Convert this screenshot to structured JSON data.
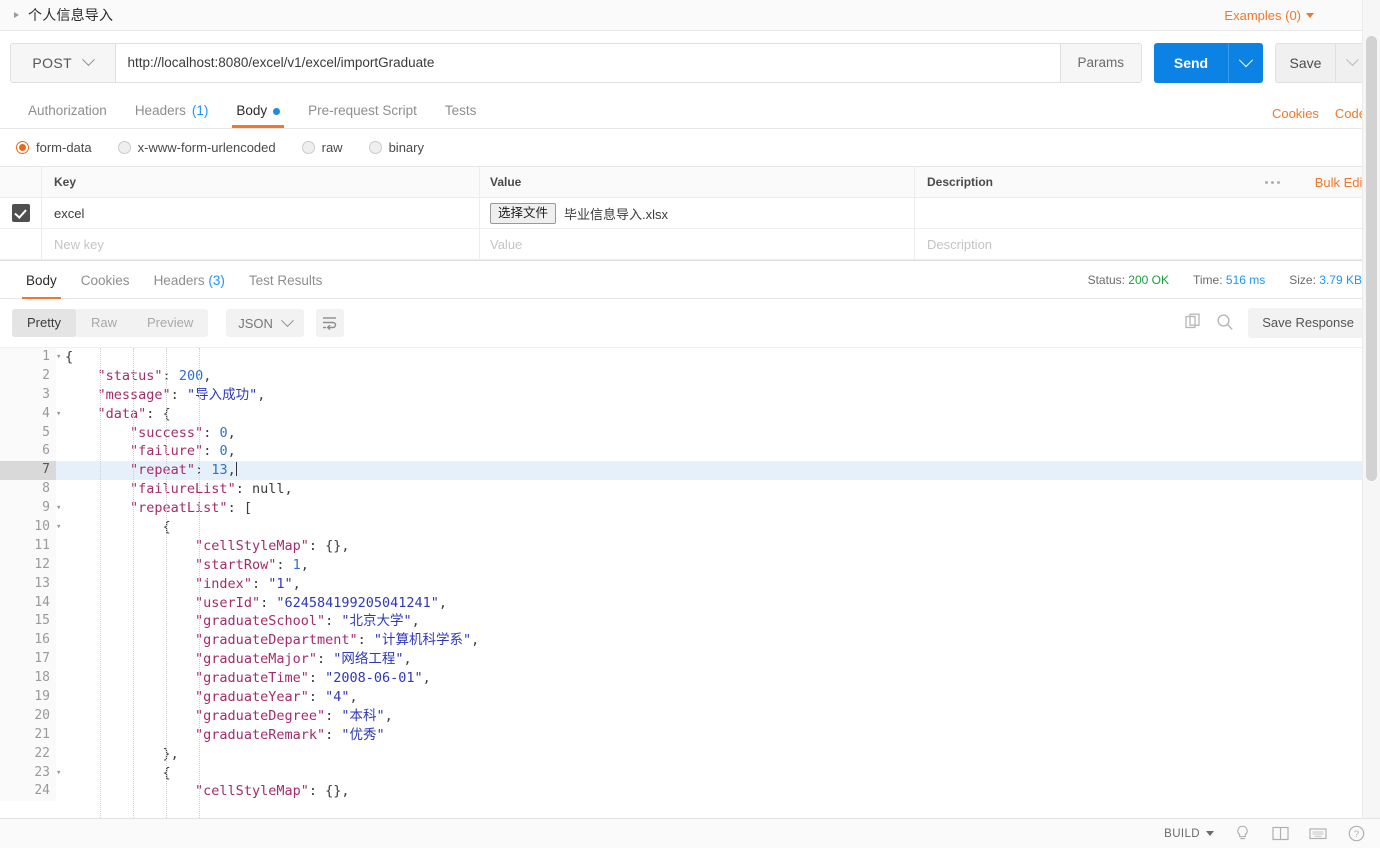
{
  "request": {
    "name": "个人信息导入",
    "examples_label": "Examples (0)",
    "method": "POST",
    "url": "http://localhost:8080/excel/v1/excel/importGraduate",
    "params_label": "Params",
    "send_label": "Send",
    "save_label": "Save",
    "tabs": [
      {
        "label": "Authorization",
        "active": false,
        "badge": ""
      },
      {
        "label": "Headers",
        "active": false,
        "badge": "(1)"
      },
      {
        "label": "Body",
        "active": true,
        "badge": ""
      },
      {
        "label": "Pre-request Script",
        "active": false,
        "badge": ""
      },
      {
        "label": "Tests",
        "active": false,
        "badge": ""
      }
    ],
    "links": {
      "cookies": "Cookies",
      "code": "Code"
    }
  },
  "body": {
    "types": [
      {
        "label": "form-data",
        "selected": true
      },
      {
        "label": "x-www-form-urlencoded",
        "selected": false
      },
      {
        "label": "raw",
        "selected": false
      },
      {
        "label": "binary",
        "selected": false
      }
    ],
    "table": {
      "headers": {
        "key": "Key",
        "value": "Value",
        "description": "Description"
      },
      "bulk_edit": "Bulk Edit",
      "rows": [
        {
          "checked": true,
          "key": "excel",
          "file_button": "选择文件",
          "file_name": "毕业信息导入.xlsx",
          "description": ""
        }
      ],
      "new_row": {
        "key_placeholder": "New key",
        "value_placeholder": "Value",
        "description_placeholder": "Description"
      }
    }
  },
  "response": {
    "tabs": [
      {
        "label": "Body",
        "active": true,
        "badge": ""
      },
      {
        "label": "Cookies",
        "active": false,
        "badge": ""
      },
      {
        "label": "Headers",
        "active": false,
        "badge": "(3)"
      },
      {
        "label": "Test Results",
        "active": false,
        "badge": ""
      }
    ],
    "status": {
      "status_label": "Status:",
      "status_value": "200 OK",
      "time_label": "Time:",
      "time_value": "516 ms",
      "size_label": "Size:",
      "size_value": "3.79 KB"
    },
    "view_modes": [
      {
        "label": "Pretty",
        "active": true
      },
      {
        "label": "Raw",
        "active": false
      },
      {
        "label": "Preview",
        "active": false
      }
    ],
    "format": "JSON",
    "save_response": "Save Response",
    "lines": [
      {
        "num": "1",
        "fold": true,
        "indent": 0,
        "tokens": [
          {
            "t": "p",
            "v": "{"
          }
        ]
      },
      {
        "num": "2",
        "fold": false,
        "indent": 1,
        "tokens": [
          {
            "t": "k",
            "v": "\"status\""
          },
          {
            "t": "p",
            "v": ": "
          },
          {
            "t": "n",
            "v": "200"
          },
          {
            "t": "p",
            "v": ","
          }
        ]
      },
      {
        "num": "3",
        "fold": false,
        "indent": 1,
        "tokens": [
          {
            "t": "k",
            "v": "\"message\""
          },
          {
            "t": "p",
            "v": ": "
          },
          {
            "t": "s",
            "v": "\"导入成功\""
          },
          {
            "t": "p",
            "v": ","
          }
        ]
      },
      {
        "num": "4",
        "fold": true,
        "indent": 1,
        "tokens": [
          {
            "t": "k",
            "v": "\"data\""
          },
          {
            "t": "p",
            "v": ": {"
          }
        ]
      },
      {
        "num": "5",
        "fold": false,
        "indent": 2,
        "tokens": [
          {
            "t": "k",
            "v": "\"success\""
          },
          {
            "t": "p",
            "v": ": "
          },
          {
            "t": "n",
            "v": "0"
          },
          {
            "t": "p",
            "v": ","
          }
        ]
      },
      {
        "num": "6",
        "fold": false,
        "indent": 2,
        "tokens": [
          {
            "t": "k",
            "v": "\"failure\""
          },
          {
            "t": "p",
            "v": ": "
          },
          {
            "t": "n",
            "v": "0"
          },
          {
            "t": "p",
            "v": ","
          }
        ]
      },
      {
        "num": "7",
        "fold": false,
        "indent": 2,
        "highlight": true,
        "cursor": true,
        "tokens": [
          {
            "t": "k",
            "v": "\"repeat\""
          },
          {
            "t": "p",
            "v": ": "
          },
          {
            "t": "n",
            "v": "13"
          },
          {
            "t": "p",
            "v": ","
          }
        ]
      },
      {
        "num": "8",
        "fold": false,
        "indent": 2,
        "tokens": [
          {
            "t": "k",
            "v": "\"failureList\""
          },
          {
            "t": "p",
            "v": ": "
          },
          {
            "t": "nul",
            "v": "null"
          },
          {
            "t": "p",
            "v": ","
          }
        ]
      },
      {
        "num": "9",
        "fold": true,
        "indent": 2,
        "tokens": [
          {
            "t": "k",
            "v": "\"repeatList\""
          },
          {
            "t": "p",
            "v": ": ["
          }
        ]
      },
      {
        "num": "10",
        "fold": true,
        "indent": 3,
        "tokens": [
          {
            "t": "p",
            "v": "{"
          }
        ]
      },
      {
        "num": "11",
        "fold": false,
        "indent": 4,
        "tokens": [
          {
            "t": "k",
            "v": "\"cellStyleMap\""
          },
          {
            "t": "p",
            "v": ": {},"
          }
        ]
      },
      {
        "num": "12",
        "fold": false,
        "indent": 4,
        "tokens": [
          {
            "t": "k",
            "v": "\"startRow\""
          },
          {
            "t": "p",
            "v": ": "
          },
          {
            "t": "n",
            "v": "1"
          },
          {
            "t": "p",
            "v": ","
          }
        ]
      },
      {
        "num": "13",
        "fold": false,
        "indent": 4,
        "tokens": [
          {
            "t": "k",
            "v": "\"index\""
          },
          {
            "t": "p",
            "v": ": "
          },
          {
            "t": "s",
            "v": "\"1\""
          },
          {
            "t": "p",
            "v": ","
          }
        ]
      },
      {
        "num": "14",
        "fold": false,
        "indent": 4,
        "tokens": [
          {
            "t": "k",
            "v": "\"userId\""
          },
          {
            "t": "p",
            "v": ": "
          },
          {
            "t": "s",
            "v": "\"624584199205041241\""
          },
          {
            "t": "p",
            "v": ","
          }
        ]
      },
      {
        "num": "15",
        "fold": false,
        "indent": 4,
        "tokens": [
          {
            "t": "k",
            "v": "\"graduateSchool\""
          },
          {
            "t": "p",
            "v": ": "
          },
          {
            "t": "s",
            "v": "\"北京大学\""
          },
          {
            "t": "p",
            "v": ","
          }
        ]
      },
      {
        "num": "16",
        "fold": false,
        "indent": 4,
        "tokens": [
          {
            "t": "k",
            "v": "\"graduateDepartment\""
          },
          {
            "t": "p",
            "v": ": "
          },
          {
            "t": "s",
            "v": "\"计算机科学系\""
          },
          {
            "t": "p",
            "v": ","
          }
        ]
      },
      {
        "num": "17",
        "fold": false,
        "indent": 4,
        "tokens": [
          {
            "t": "k",
            "v": "\"graduateMajor\""
          },
          {
            "t": "p",
            "v": ": "
          },
          {
            "t": "s",
            "v": "\"网络工程\""
          },
          {
            "t": "p",
            "v": ","
          }
        ]
      },
      {
        "num": "18",
        "fold": false,
        "indent": 4,
        "tokens": [
          {
            "t": "k",
            "v": "\"graduateTime\""
          },
          {
            "t": "p",
            "v": ": "
          },
          {
            "t": "s",
            "v": "\"2008-06-01\""
          },
          {
            "t": "p",
            "v": ","
          }
        ]
      },
      {
        "num": "19",
        "fold": false,
        "indent": 4,
        "tokens": [
          {
            "t": "k",
            "v": "\"graduateYear\""
          },
          {
            "t": "p",
            "v": ": "
          },
          {
            "t": "s",
            "v": "\"4\""
          },
          {
            "t": "p",
            "v": ","
          }
        ]
      },
      {
        "num": "20",
        "fold": false,
        "indent": 4,
        "tokens": [
          {
            "t": "k",
            "v": "\"graduateDegree\""
          },
          {
            "t": "p",
            "v": ": "
          },
          {
            "t": "s",
            "v": "\"本科\""
          },
          {
            "t": "p",
            "v": ","
          }
        ]
      },
      {
        "num": "21",
        "fold": false,
        "indent": 4,
        "tokens": [
          {
            "t": "k",
            "v": "\"graduateRemark\""
          },
          {
            "t": "p",
            "v": ": "
          },
          {
            "t": "s",
            "v": "\"优秀\""
          }
        ]
      },
      {
        "num": "22",
        "fold": false,
        "indent": 3,
        "tokens": [
          {
            "t": "p",
            "v": "},"
          }
        ]
      },
      {
        "num": "23",
        "fold": true,
        "indent": 3,
        "tokens": [
          {
            "t": "p",
            "v": "{"
          }
        ]
      },
      {
        "num": "24",
        "fold": false,
        "indent": 4,
        "tokens": [
          {
            "t": "k",
            "v": "\"cellStyleMap\""
          },
          {
            "t": "p",
            "v": ": {},"
          }
        ]
      }
    ]
  },
  "statusbar": {
    "build_label": "BUILD"
  },
  "colors": {
    "accent_orange": "#f0772b",
    "send_blue": "#0d82e5",
    "status_green": "#1a9e3e",
    "link_blue": "#2196f3"
  }
}
